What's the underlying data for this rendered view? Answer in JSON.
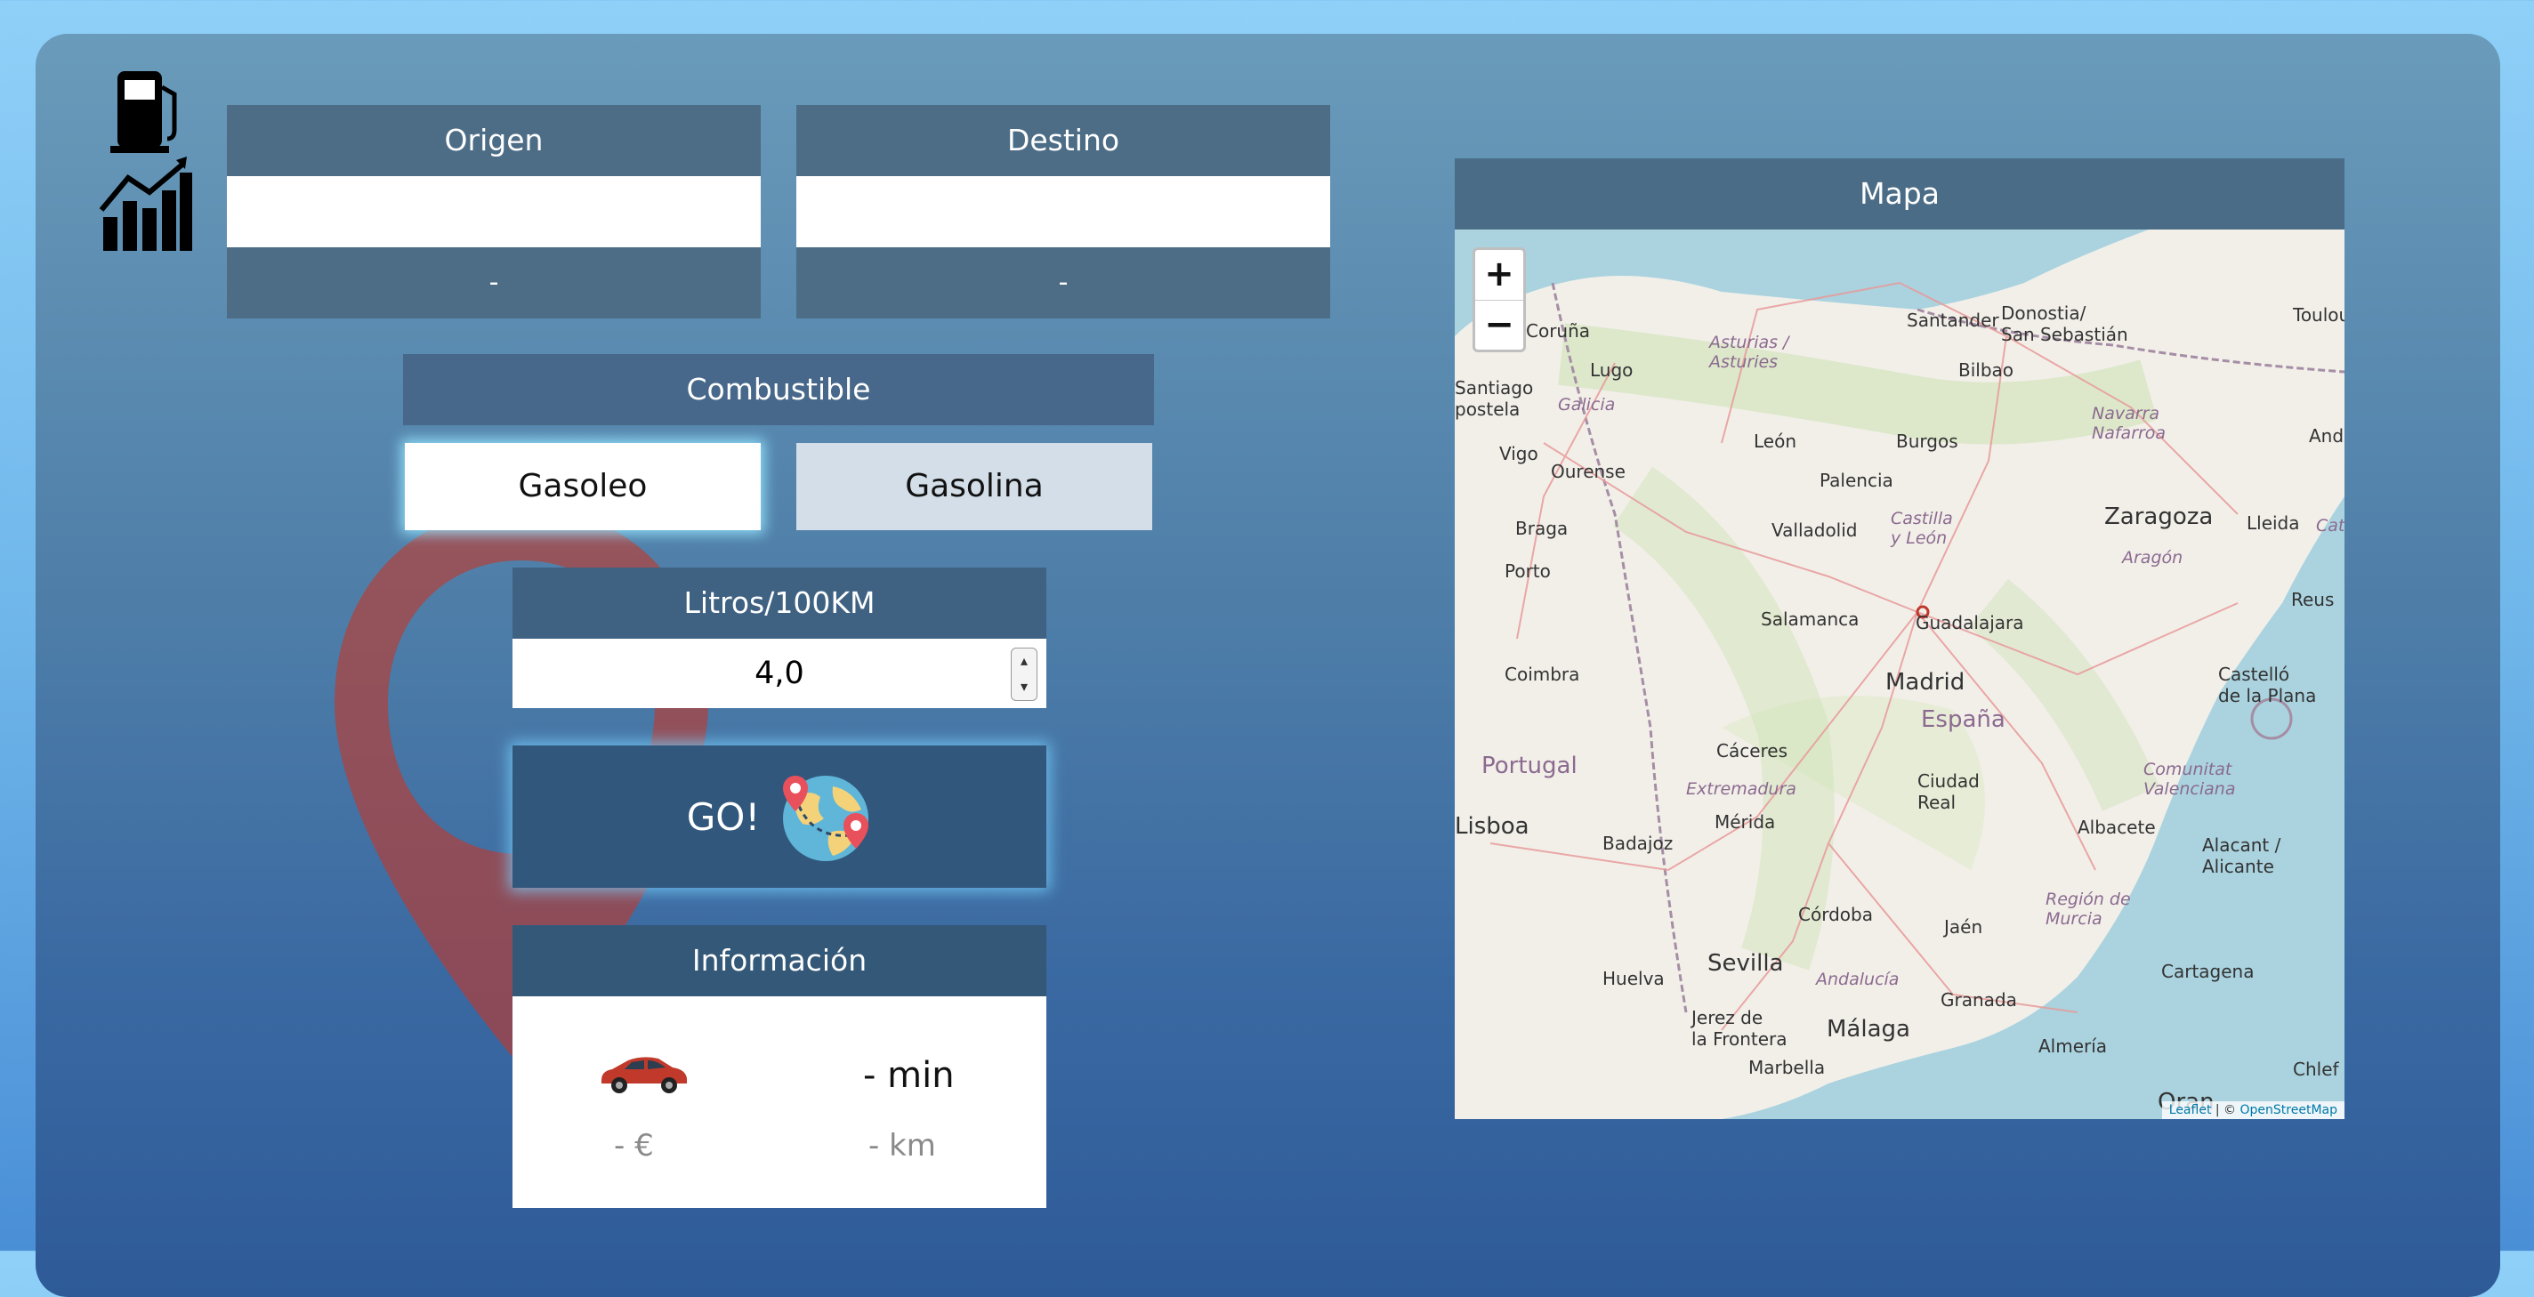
{
  "origin": {
    "title": "Origen",
    "value": "",
    "result": "-"
  },
  "destination": {
    "title": "Destino",
    "value": "",
    "result": "-"
  },
  "fuel": {
    "title": "Combustible",
    "options": [
      "Gasoleo",
      "Gasolina"
    ],
    "selected": "Gasoleo"
  },
  "consumption": {
    "title": "Litros/100KM",
    "value": "4,0"
  },
  "go_button": {
    "label": "GO!"
  },
  "info": {
    "title": "Información",
    "time": "- min",
    "cost": "- €",
    "distance": "- km"
  },
  "map": {
    "title": "Mapa",
    "zoom_in": "+",
    "zoom_out": "−",
    "attribution_leaflet": "Leaflet",
    "attribution_sep": " | © ",
    "attribution_osm": "OpenStreetMap",
    "labels": {
      "toulouse": "Toulouse",
      "santander": "Santander",
      "donostia": "Donostia/\nSan Sebastián",
      "coruna": "Coruña",
      "asturias": "Asturias /\nAsturies",
      "lugo": "Lugo",
      "bilbao": "Bilbao",
      "santiago": "Santiago\npostela",
      "galicia": "Galicia",
      "navarra": "Navarra\nNafarroa",
      "leon": "León",
      "burgos": "Burgos",
      "ourense": "Ourense",
      "vigo": "Vigo",
      "palencia": "Palencia",
      "and": "And",
      "braga": "Braga",
      "valladolid": "Valladolid",
      "castilla": "Castilla\ny León",
      "zaragoza": "Zaragoza",
      "lleida": "Lleida",
      "cat": "Cata",
      "aragon": "Aragón",
      "porto": "Porto",
      "salamanca": "Salamanca",
      "guadalajara": "Guadalajara",
      "reus": "Reus",
      "madrid": "Madrid",
      "coimbra": "Coimbra",
      "espana": "España",
      "castello": "Castelló\nde la Plana",
      "caceres": "Cáceres",
      "portugal": "Portugal",
      "ciudadreal": "Ciudad\nReal",
      "comunitat": "Comunitat\nValenciana",
      "extremadura": "Extremadura",
      "merida": "Mérida",
      "lisboa": "Lisboa",
      "badajoz": "Badajoz",
      "albacete": "Albacete",
      "alacant": "Alacant /\nAlicante",
      "cordoba": "Córdoba",
      "jaen": "Jaén",
      "murcia": "Región de\nMurcia",
      "huelva": "Huelva",
      "sevilla": "Sevilla",
      "andalucia": "Andalucía",
      "granada": "Granada",
      "cartagena": "Cartagena",
      "jerez": "Jerez de\nla Frontera",
      "malaga": "Málaga",
      "almeria": "Almería",
      "marbella": "Marbella",
      "chlef": "Chlef",
      "oran": "Oran"
    }
  },
  "colors": {
    "header": "#4d6d87",
    "go_button": "#32577c",
    "pin": "#c0392b"
  },
  "icons": [
    "fuel-pump-icon",
    "growth-chart-icon",
    "car-icon",
    "globe-route-icon",
    "location-pin-icon"
  ]
}
